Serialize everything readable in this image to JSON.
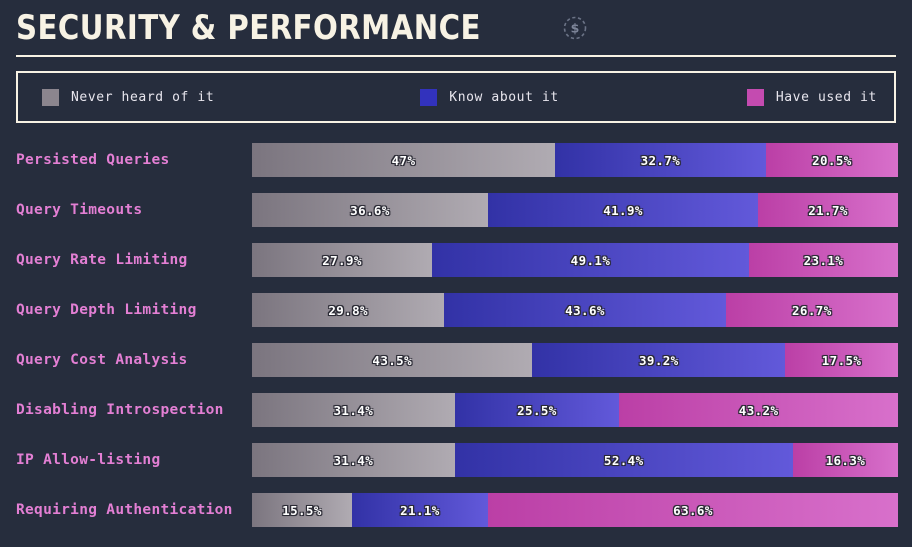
{
  "header": {
    "title": "SECURITY & PERFORMANCE",
    "icon": "dollar-circle-icon"
  },
  "legend": {
    "items": [
      {
        "label": "Never heard of it",
        "color": "#8b858e",
        "key": "never_heard"
      },
      {
        "label": "Know about it",
        "color": "#3232bd",
        "key": "know_about"
      },
      {
        "label": "Have used it",
        "color": "#c44bb0",
        "key": "have_used"
      }
    ]
  },
  "colors": {
    "background": "#262d3d",
    "accent_rule": "#f7f2e4",
    "row_label": "#e37fd4",
    "never_heard_start": "#7b757f",
    "never_heard_end": "#b0abb2",
    "know_about_start": "#3232a6",
    "know_about_end": "#6259da",
    "have_used_start": "#bb3fa6",
    "have_used_end": "#d870cb"
  },
  "chart_data": {
    "type": "bar",
    "orientation": "horizontal",
    "stacked": true,
    "normalized": true,
    "title": "SECURITY & PERFORMANCE",
    "xlabel": "",
    "ylabel": "",
    "xlim": [
      0,
      100
    ],
    "grid": false,
    "legend_position": "top",
    "categories": [
      "Persisted Queries",
      "Query Timeouts",
      "Query Rate Limiting",
      "Query Depth Limiting",
      "Query Cost Analysis",
      "Disabling Introspection",
      "IP Allow-listing",
      "Requiring Authentication"
    ],
    "series": [
      {
        "name": "Never heard of it",
        "values": [
          47,
          36.6,
          27.9,
          29.8,
          43.5,
          31.4,
          31.4,
          15.5
        ]
      },
      {
        "name": "Know about it",
        "values": [
          32.7,
          41.9,
          49.1,
          43.6,
          39.2,
          25.5,
          52.4,
          21.1
        ]
      },
      {
        "name": "Have used it",
        "values": [
          20.5,
          21.7,
          23.1,
          26.7,
          17.5,
          43.2,
          16.3,
          63.6
        ]
      }
    ],
    "rows": [
      {
        "label": "Persisted Queries",
        "segments": [
          {
            "value": 47,
            "text": "47%"
          },
          {
            "value": 32.7,
            "text": "32.7%"
          },
          {
            "value": 20.5,
            "text": "20.5%"
          }
        ]
      },
      {
        "label": "Query Timeouts",
        "segments": [
          {
            "value": 36.6,
            "text": "36.6%"
          },
          {
            "value": 41.9,
            "text": "41.9%"
          },
          {
            "value": 21.7,
            "text": "21.7%"
          }
        ]
      },
      {
        "label": "Query Rate Limiting",
        "segments": [
          {
            "value": 27.9,
            "text": "27.9%"
          },
          {
            "value": 49.1,
            "text": "49.1%"
          },
          {
            "value": 23.1,
            "text": "23.1%"
          }
        ]
      },
      {
        "label": "Query Depth Limiting",
        "segments": [
          {
            "value": 29.8,
            "text": "29.8%"
          },
          {
            "value": 43.6,
            "text": "43.6%"
          },
          {
            "value": 26.7,
            "text": "26.7%"
          }
        ]
      },
      {
        "label": "Query Cost Analysis",
        "segments": [
          {
            "value": 43.5,
            "text": "43.5%"
          },
          {
            "value": 39.2,
            "text": "39.2%"
          },
          {
            "value": 17.5,
            "text": "17.5%"
          }
        ]
      },
      {
        "label": "Disabling Introspection",
        "segments": [
          {
            "value": 31.4,
            "text": "31.4%"
          },
          {
            "value": 25.5,
            "text": "25.5%"
          },
          {
            "value": 43.2,
            "text": "43.2%"
          }
        ]
      },
      {
        "label": "IP Allow-listing",
        "segments": [
          {
            "value": 31.4,
            "text": "31.4%"
          },
          {
            "value": 52.4,
            "text": "52.4%"
          },
          {
            "value": 16.3,
            "text": "16.3%"
          }
        ]
      },
      {
        "label": "Requiring Authentication",
        "segments": [
          {
            "value": 15.5,
            "text": "15.5%"
          },
          {
            "value": 21.1,
            "text": "21.1%"
          },
          {
            "value": 63.6,
            "text": "63.6%"
          }
        ]
      }
    ]
  }
}
